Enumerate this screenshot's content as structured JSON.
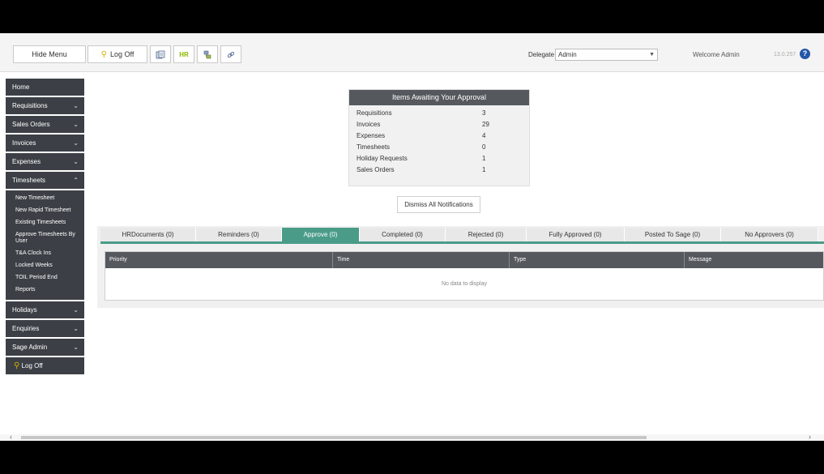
{
  "toolbar": {
    "hide_menu": "Hide Menu",
    "log_off": "Log Off",
    "hr_label": "HR",
    "delegate_label": "Delegate",
    "delegate_value": "Admin",
    "welcome": "Welcome Admin",
    "version": "13.0.257"
  },
  "sidebar": {
    "home": "Home",
    "requisitions": "Requisitions",
    "sales_orders": "Sales Orders",
    "invoices": "Invoices",
    "expenses": "Expenses",
    "timesheets": "Timesheets",
    "timesheet_sub": [
      "New Timesheet",
      "New Rapid Timesheet",
      "Existing Timesheets",
      "Approve Timesheets By User",
      "T&A Clock Ins",
      "Locked Weeks",
      "TOIL Period End",
      "Reports"
    ],
    "holidays": "Holidays",
    "enquiries": "Enquiries",
    "sage_admin": "Sage Admin",
    "log_off": "Log Off"
  },
  "approval": {
    "title": "Items Awaiting Your Approval",
    "rows": [
      {
        "label": "Requisitions",
        "value": "3"
      },
      {
        "label": "Invoices",
        "value": "29"
      },
      {
        "label": "Expenses",
        "value": "4"
      },
      {
        "label": "Timesheets",
        "value": "0"
      },
      {
        "label": "Holiday Requests",
        "value": "1"
      },
      {
        "label": "Sales Orders",
        "value": "1"
      }
    ]
  },
  "dismiss_label": "Dismiss All Notifications",
  "tabs": [
    {
      "label": "HRDocuments (0)",
      "active": false
    },
    {
      "label": "Reminders (0)",
      "active": false
    },
    {
      "label": "Approve (0)",
      "active": true
    },
    {
      "label": "Completed (0)",
      "active": false
    },
    {
      "label": "Rejected (0)",
      "active": false
    },
    {
      "label": "Fully Approved (0)",
      "active": false
    },
    {
      "label": "Posted To Sage (0)",
      "active": false
    },
    {
      "label": "No Approvers (0)",
      "active": false
    }
  ],
  "grid": {
    "columns": [
      "Priority",
      "Time",
      "Type",
      "Message"
    ],
    "empty_text": "No data to display"
  },
  "colors": {
    "accent": "#4a9c89",
    "nav_bg": "#3c4046",
    "header_bg": "#55595e"
  }
}
